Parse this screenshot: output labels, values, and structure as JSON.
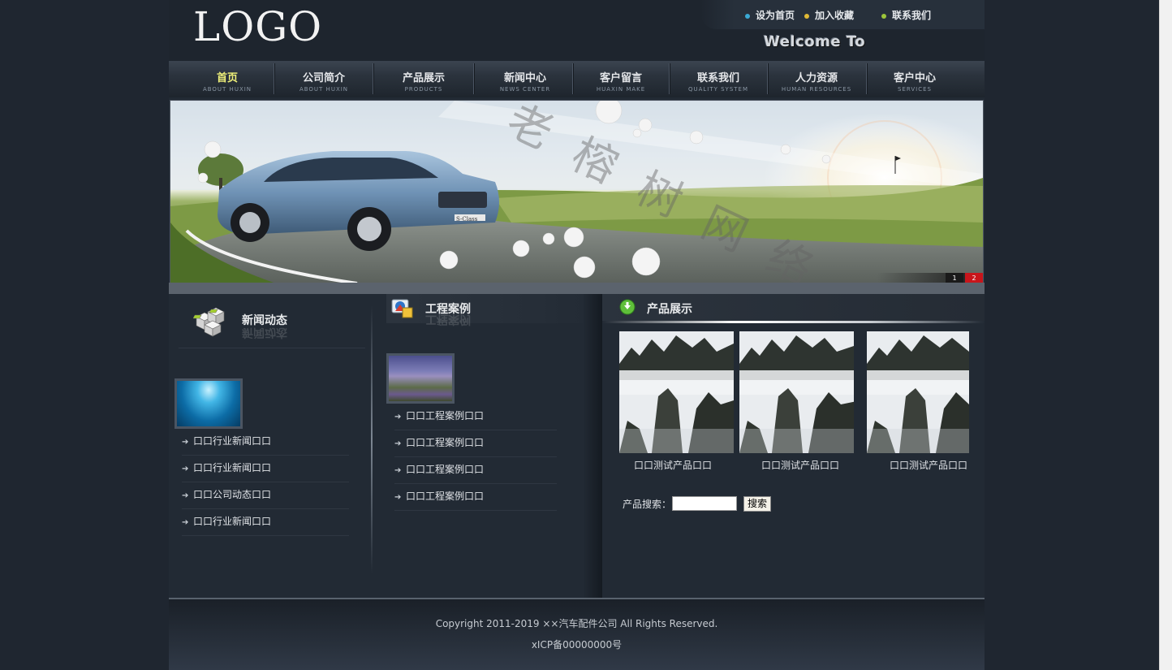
{
  "header": {
    "logo": "LOGO",
    "welcome": "Welcome To",
    "top_links": [
      {
        "label": "设为首页",
        "dot_color": "#3aa9d4"
      },
      {
        "label": "加入收藏",
        "dot_color": "#e0b935"
      },
      {
        "label": "联系我们",
        "dot_color": "#9cc53a"
      }
    ]
  },
  "nav": [
    {
      "label": "首页",
      "sub": "ABOUT HUXIN"
    },
    {
      "label": "公司简介",
      "sub": "ABOUT HUXIN"
    },
    {
      "label": "产品展示",
      "sub": "PRODUCTS"
    },
    {
      "label": "新闻中心",
      "sub": "NEWS CENTER"
    },
    {
      "label": "客户留言",
      "sub": "HUAXIN MAKE"
    },
    {
      "label": "联系我们",
      "sub": "QUALITY SYSTEM"
    },
    {
      "label": "人力资源",
      "sub": "HUMAN RESOURCES"
    },
    {
      "label": "客户中心",
      "sub": "SERVICES"
    }
  ],
  "banner": {
    "watermark": [
      "老",
      "榕",
      "树",
      "网",
      "络"
    ],
    "slides": [
      "1",
      "2"
    ],
    "active_slide": "2",
    "car_badge": "S-Class"
  },
  "news": {
    "title": "新闻动态",
    "items": [
      "口口行业新闻口口",
      "口口行业新闻口口",
      "口口公司动态口口",
      "口口行业新闻口口"
    ]
  },
  "cases": {
    "title": "工程案例",
    "items": [
      "口口工程案例口口",
      "口口工程案例口口",
      "口口工程案例口口",
      "口口工程案例口口"
    ]
  },
  "products": {
    "title": "产品展示",
    "items": [
      "口口测试产品口口",
      "口口测试产品口口",
      "口口测试产品口口"
    ],
    "search_label": "产品搜索：",
    "search_value": "",
    "search_button": "搜索"
  },
  "footer": {
    "copyright": "Copyright 2011-2019 ××汽车配件公司 All Rights Reserved.",
    "icp": "xICP备00000000号"
  }
}
